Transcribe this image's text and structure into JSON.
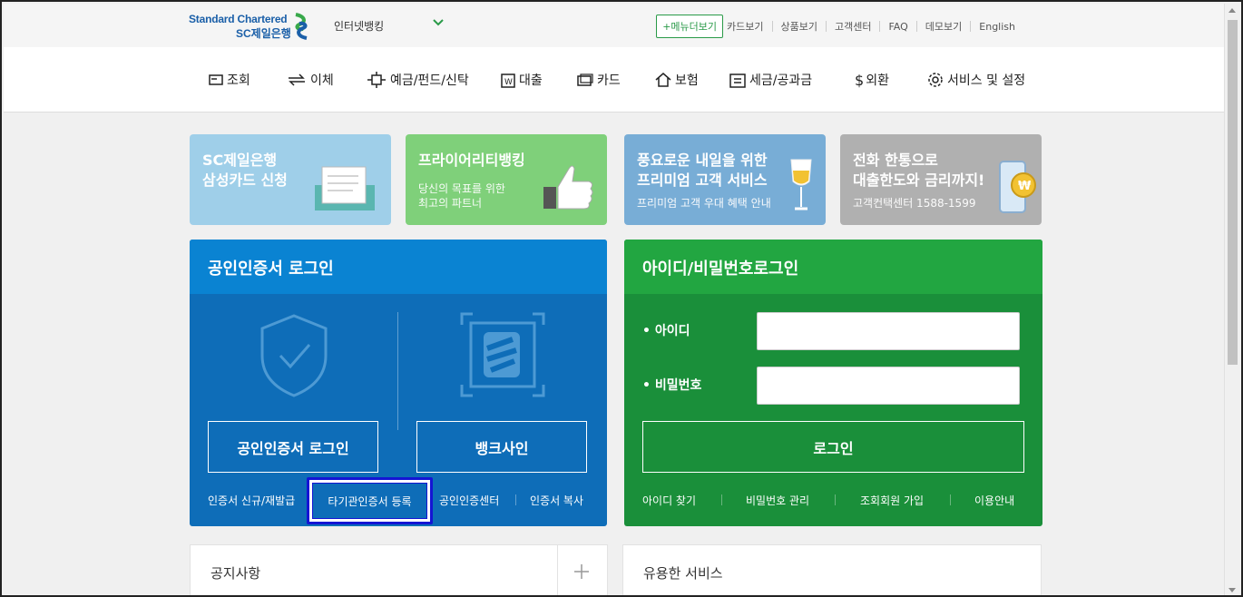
{
  "header": {
    "logo_line1": "Standard Chartered",
    "logo_line2": "SC제일은행",
    "bank_select": "인터넷뱅킹",
    "menu_button": "+메뉴더보기",
    "links": [
      "카드보기",
      "상품보기",
      "고객센터",
      "FAQ",
      "데모보기",
      "English"
    ]
  },
  "nav": {
    "items": [
      "조회",
      "이체",
      "예금/펀드/신탁",
      "대출",
      "카드",
      "보험",
      "세금/공과금",
      "외환",
      "서비스 및 설정"
    ]
  },
  "banners": [
    {
      "title_line1": "SC제일은행",
      "title_line2": "삼성카드 신청",
      "color": "#9fcfe9"
    },
    {
      "title_line1": "프라이어리티뱅킹",
      "sub1": "당신의 목표를 위한",
      "sub2": "최고의 파트너",
      "color": "#7fd07a"
    },
    {
      "title_line1": "풍요로운 내일을 위한",
      "title_line2": "프리미엄 고객 서비스",
      "sub1": "프리미엄 고객 우대 혜택 안내",
      "color": "#78add6"
    },
    {
      "title_line1": "전화 한통으로",
      "title_line2": "대출한도와 금리까지!",
      "sub1": "고객컨택센터 1588-1599",
      "color": "#b0b0b0"
    }
  ],
  "cert_login": {
    "title": "공인인증서 로그인",
    "cert_button": "공인인증서 로그인",
    "banksign_button": "뱅크사인",
    "links": [
      "인증서 신규/재발급",
      "타기관인증서 등록",
      "공인인증센터",
      "인증서 복사"
    ]
  },
  "id_login": {
    "title": "아이디/비밀번호로그인",
    "id_label": "• 아이디",
    "pw_label": "• 비밀번호",
    "login_button": "로그인",
    "links": [
      "아이디 찾기",
      "비밀번호 관리",
      "조회회원 가입",
      "이용안내"
    ]
  },
  "cards": {
    "notice_title": "공지사항",
    "service_title": "유용한 서비스"
  },
  "colors": {
    "accent_green": "#2a9a48",
    "cert_blue": "#0e6db8",
    "highlight": "#1414d4"
  }
}
